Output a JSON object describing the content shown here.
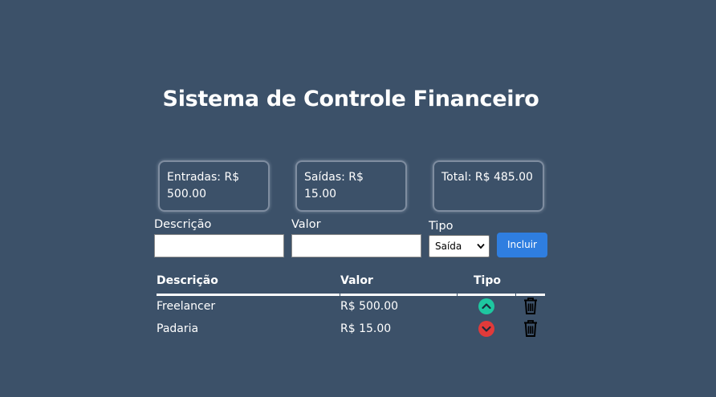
{
  "header": {
    "title": "Sistema de Controle Financeiro"
  },
  "summary": {
    "entradas": "Entradas: R$ 500.00",
    "saidas": "Saídas: R$ 15.00",
    "total": "Total: R$ 485.00"
  },
  "form": {
    "descricao_label": "Descrição",
    "descricao_value": "",
    "valor_label": "Valor",
    "valor_value": "",
    "tipo_label": "Tipo",
    "tipo_selected": "Saída",
    "incluir_label": "Incluir"
  },
  "table": {
    "headers": [
      "Descrição",
      "Valor",
      "Tipo"
    ],
    "rows": [
      {
        "descricao": "Freelancer",
        "valor": "R$ 500.00",
        "tipo": "entrada",
        "tipo_icon": "arrow-up-circle-icon",
        "icon_color": "#1ec7a0"
      },
      {
        "descricao": "Padaria",
        "valor": "R$ 15.00",
        "tipo": "saida",
        "tipo_icon": "arrow-down-circle-icon",
        "icon_color": "#e03a3a"
      }
    ]
  },
  "colors": {
    "background": "#3c5169",
    "button": "#2f7ee0",
    "income": "#1ec7a0",
    "expense": "#e03a3a"
  }
}
